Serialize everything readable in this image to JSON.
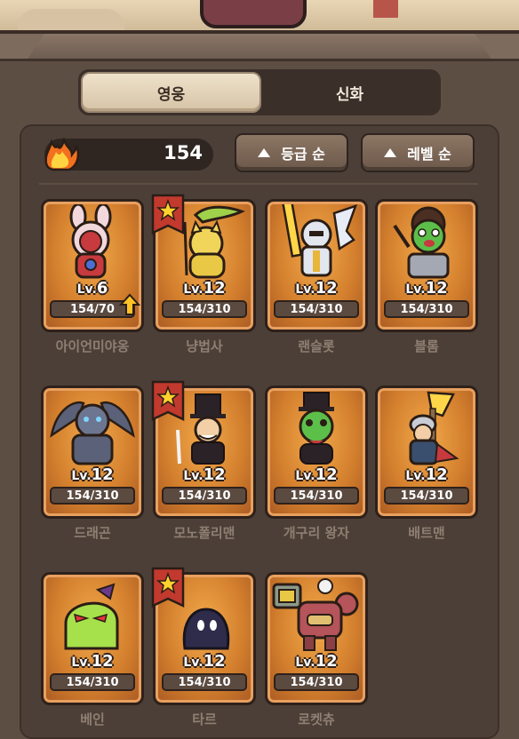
{
  "tabs": [
    {
      "label": "영웅",
      "active": true
    },
    {
      "label": "신화",
      "active": false
    }
  ],
  "currency": {
    "icon": "flame-icon",
    "value": "154"
  },
  "sort": {
    "grade_label": "등급 순",
    "level_label": "레벨 순",
    "icon": "triangle-up-icon"
  },
  "heroes": [
    {
      "name": "아이언미야옹",
      "level_prefix": "Lv.",
      "level": "6",
      "exp": "154/70",
      "starred": false,
      "upgrade_available": true
    },
    {
      "name": "냥법사",
      "level_prefix": "Lv.",
      "level": "12",
      "exp": "154/310",
      "starred": true,
      "upgrade_available": false
    },
    {
      "name": "랜슬롯",
      "level_prefix": "Lv.",
      "level": "12",
      "exp": "154/310",
      "starred": false,
      "upgrade_available": false
    },
    {
      "name": "블롬",
      "level_prefix": "Lv.",
      "level": "12",
      "exp": "154/310",
      "starred": false,
      "upgrade_available": false
    },
    {
      "name": "드래곤",
      "level_prefix": "Lv.",
      "level": "12",
      "exp": "154/310",
      "starred": false,
      "upgrade_available": false
    },
    {
      "name": "모노폴리맨",
      "level_prefix": "Lv.",
      "level": "12",
      "exp": "154/310",
      "starred": true,
      "upgrade_available": false
    },
    {
      "name": "개구리 왕자",
      "level_prefix": "Lv.",
      "level": "12",
      "exp": "154/310",
      "starred": false,
      "upgrade_available": false
    },
    {
      "name": "배트맨",
      "level_prefix": "Lv.",
      "level": "12",
      "exp": "154/310",
      "starred": false,
      "upgrade_available": false
    },
    {
      "name": "베인",
      "level_prefix": "Lv.",
      "level": "12",
      "exp": "154/310",
      "starred": false,
      "upgrade_available": false
    },
    {
      "name": "타르",
      "level_prefix": "Lv.",
      "level": "12",
      "exp": "154/310",
      "starred": true,
      "upgrade_available": false
    },
    {
      "name": "로켓츄",
      "level_prefix": "Lv.",
      "level": "12",
      "exp": "154/310",
      "starred": false,
      "upgrade_available": false
    }
  ],
  "colors": {
    "card_glow": "#f2a94a",
    "card_base": "#d4802e",
    "star_flag": "#c2392e",
    "star": "#ffd22e",
    "upgrade_arrow": "#ffc224"
  }
}
